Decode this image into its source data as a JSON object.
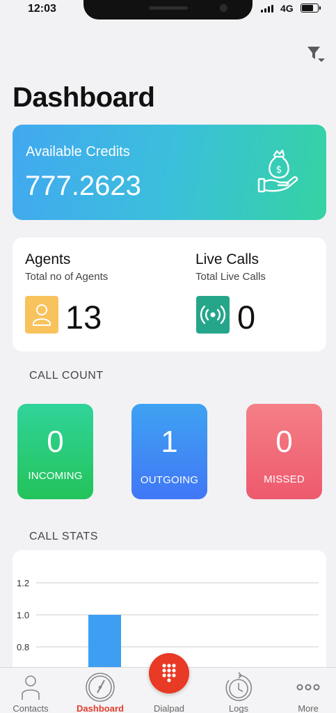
{
  "status_bar": {
    "time": "12:03",
    "network": "4G",
    "battery_level": 0.8
  },
  "header": {
    "title": "Dashboard",
    "filter_icon": "filter-icon"
  },
  "credits": {
    "label": "Available Credits",
    "value": "777.2623",
    "icon": "money-bag-hand-icon"
  },
  "agents": {
    "title": "Agents",
    "subtitle": "Total no of Agents",
    "value": "13",
    "icon": "person-icon",
    "color": "#f8c25c"
  },
  "live_calls": {
    "title": "Live Calls",
    "subtitle": "Total Live Calls",
    "value": "0",
    "icon": "broadcast-icon",
    "color": "#25a58a"
  },
  "call_count": {
    "title": "CALL COUNT",
    "tiles": [
      {
        "value": "0",
        "label": "INCOMING",
        "color": "#2ecb7a"
      },
      {
        "value": "1",
        "label": "OUTGOING",
        "color": "#3f8ef5"
      },
      {
        "value": "0",
        "label": "MISSED",
        "color": "#f06274"
      }
    ]
  },
  "call_stats": {
    "title": "CALL STATS",
    "chart_data": {
      "type": "bar",
      "yticks": [
        "1.2",
        "1.0",
        "0.8"
      ],
      "ylim_visible": [
        0.8,
        1.2
      ],
      "values": [
        1
      ],
      "bar_color": "#3e9ef2",
      "grid": true
    }
  },
  "tabs": [
    {
      "label": "Contacts",
      "icon": "contacts-icon",
      "active": false
    },
    {
      "label": "Dashboard",
      "icon": "dashboard-gauge-icon",
      "active": true
    },
    {
      "label": "Dialpad",
      "icon": "dialpad-icon",
      "active": false
    },
    {
      "label": "Logs",
      "icon": "logs-clock-icon",
      "active": false
    },
    {
      "label": "More",
      "icon": "more-dots-icon",
      "active": false
    }
  ],
  "colors": {
    "accent": "#e83a25",
    "credits_gradient_start": "#42a8f0",
    "credits_gradient_end": "#35d3a2"
  }
}
